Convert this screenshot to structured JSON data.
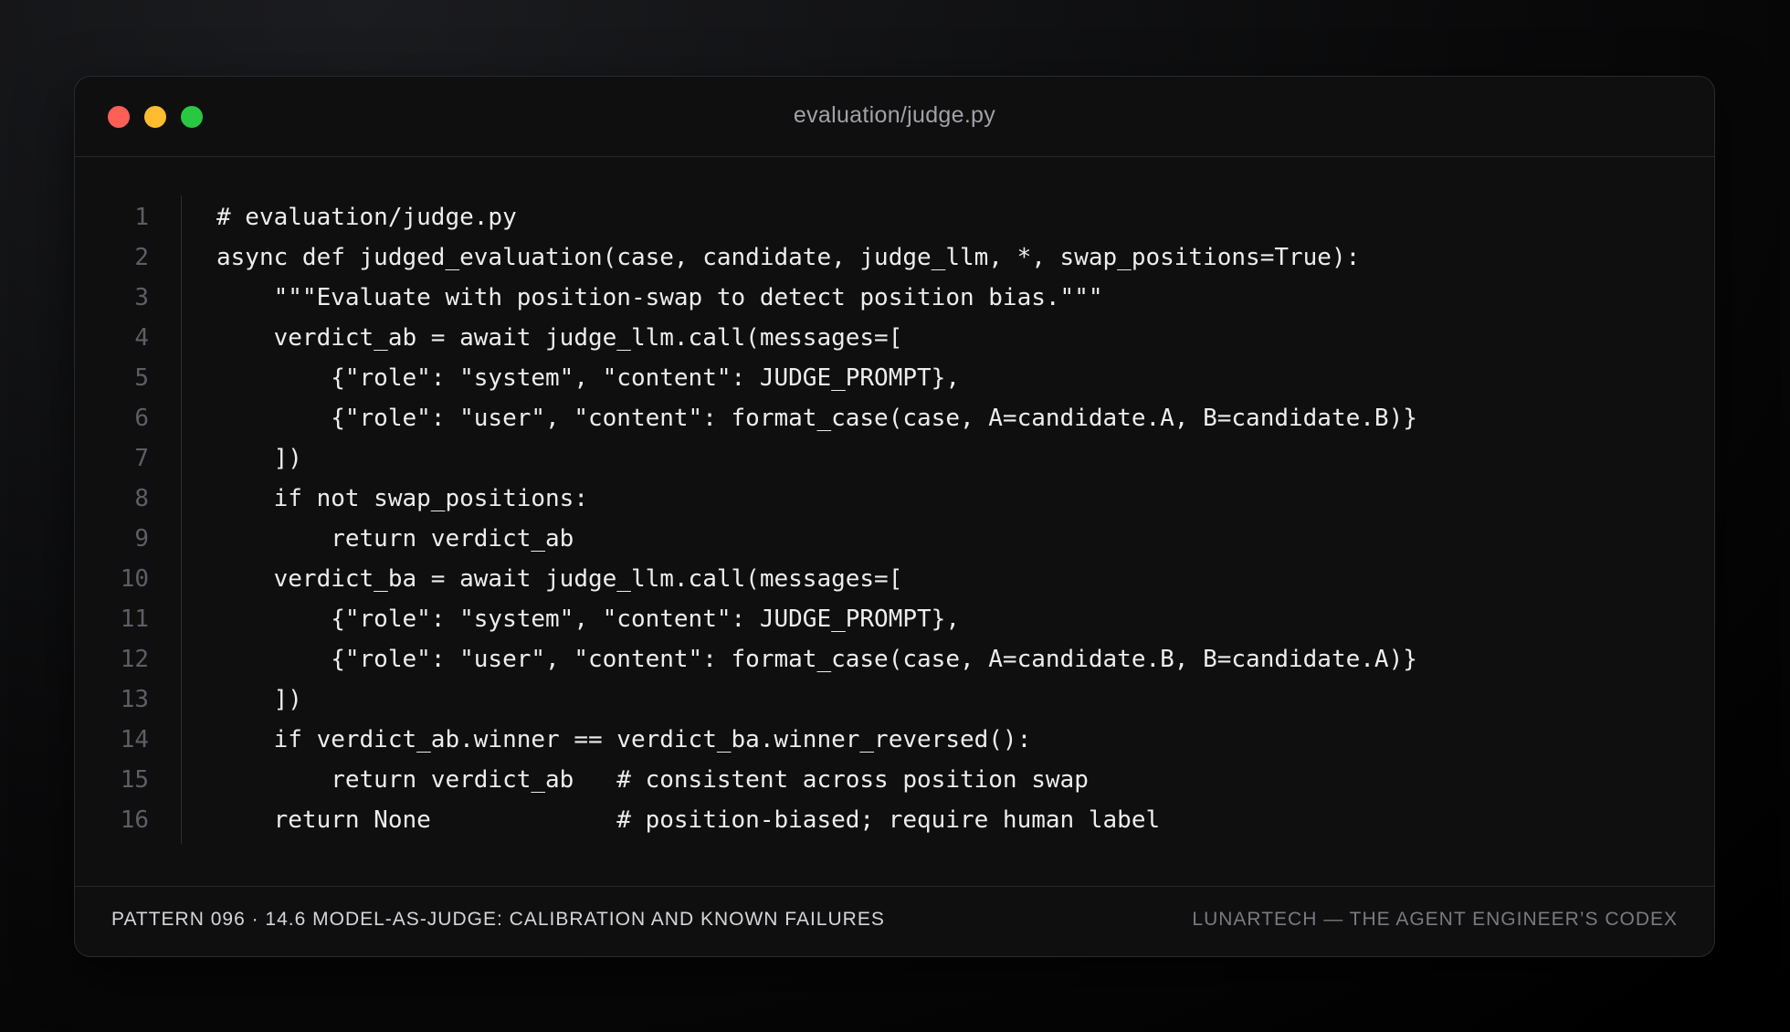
{
  "window": {
    "title": "evaluation/judge.py"
  },
  "code": {
    "lines": [
      {
        "num": "1",
        "text": "# evaluation/judge.py"
      },
      {
        "num": "2",
        "text": "async def judged_evaluation(case, candidate, judge_llm, *, swap_positions=True):"
      },
      {
        "num": "3",
        "text": "    \"\"\"Evaluate with position-swap to detect position bias.\"\"\""
      },
      {
        "num": "4",
        "text": "    verdict_ab = await judge_llm.call(messages=["
      },
      {
        "num": "5",
        "text": "        {\"role\": \"system\", \"content\": JUDGE_PROMPT},"
      },
      {
        "num": "6",
        "text": "        {\"role\": \"user\", \"content\": format_case(case, A=candidate.A, B=candidate.B)}"
      },
      {
        "num": "7",
        "text": "    ])"
      },
      {
        "num": "8",
        "text": "    if not swap_positions:"
      },
      {
        "num": "9",
        "text": "        return verdict_ab"
      },
      {
        "num": "10",
        "text": "    verdict_ba = await judge_llm.call(messages=["
      },
      {
        "num": "11",
        "text": "        {\"role\": \"system\", \"content\": JUDGE_PROMPT},"
      },
      {
        "num": "12",
        "text": "        {\"role\": \"user\", \"content\": format_case(case, A=candidate.B, B=candidate.A)}"
      },
      {
        "num": "13",
        "text": "    ])"
      },
      {
        "num": "14",
        "text": "    if verdict_ab.winner == verdict_ba.winner_reversed():"
      },
      {
        "num": "15",
        "text": "        return verdict_ab   # consistent across position swap"
      },
      {
        "num": "16",
        "text": "    return None             # position-biased; require human label"
      }
    ]
  },
  "footer": {
    "left": "PATTERN 096 · 14.6 MODEL-AS-JUDGE: CALIBRATION AND KNOWN FAILURES",
    "right": "LUNARTECH — THE AGENT ENGINEER’S CODEX"
  },
  "colors": {
    "close": "#ff5f57",
    "minimize": "#febc2e",
    "maximize": "#28c840"
  }
}
